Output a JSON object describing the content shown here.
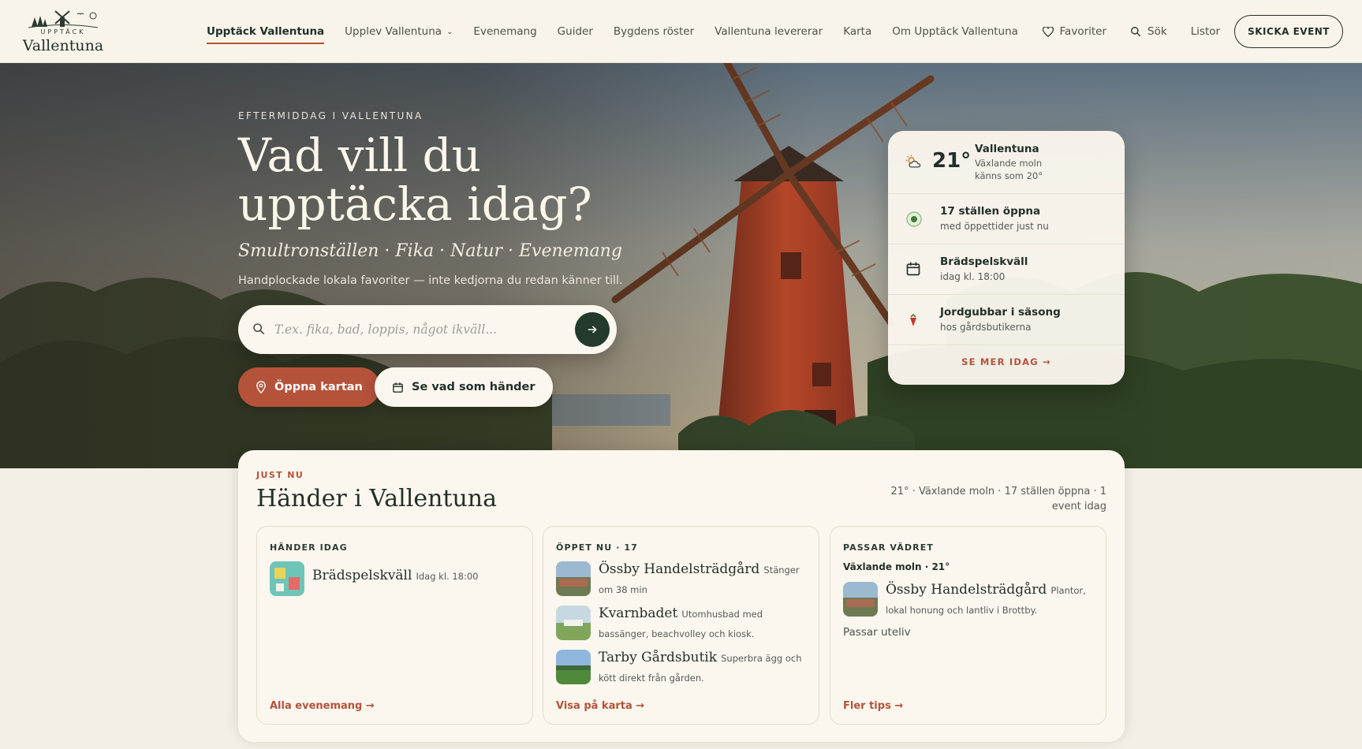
{
  "logo": {
    "small": "UPPTÄCK",
    "big": "Vallentuna"
  },
  "nav": {
    "items": [
      {
        "label": "Upptäck Vallentuna",
        "active": true
      },
      {
        "label": "Upplev Vallentuna",
        "dropdown": true
      },
      {
        "label": "Evenemang"
      },
      {
        "label": "Guider"
      },
      {
        "label": "Bygdens röster"
      },
      {
        "label": "Vallentuna levererar"
      },
      {
        "label": "Karta"
      },
      {
        "label": "Om Upptäck Vallentuna"
      }
    ]
  },
  "utility": {
    "favorites": "Favoriter",
    "search": "Sök",
    "lists": "Listor",
    "cta": "SKICKA EVENT"
  },
  "hero": {
    "eyebrow": "EFTERMIDDAG I VALLENTUNA",
    "title": "Vad vill du upptäcka idag?",
    "tags": "Smultronställen · Fika · Natur · Evenemang",
    "subtitle": "Handplockade lokala favoriter — inte kedjorna du redan känner till.",
    "search_placeholder": "T.ex. fika, bad, loppis, något ikväll...",
    "primary_button": "Öppna kartan",
    "secondary_button": "Se vad som händer"
  },
  "today_widget": {
    "temperature": "21°",
    "city": "Vallentuna",
    "condition": "Växlande moln",
    "feels_like": "känns som 20°",
    "rows": [
      {
        "icon": "open-status-icon",
        "title": "17 ställen öppna",
        "sub": "med öppettider just nu"
      },
      {
        "icon": "calendar-icon",
        "title": "Brädspelskväll",
        "sub": "idag kl. 18:00"
      },
      {
        "icon": "strawberry-icon",
        "title": "Jordgubbar i säsong",
        "sub": "hos gårdsbutikerna"
      }
    ],
    "more_link": "SE MER IDAG →"
  },
  "just_now": {
    "eyebrow": "JUST NU",
    "title": "Händer i Vallentuna",
    "status": "21° · Växlande moln · 17 ställen öppna · 1 event idag",
    "cards": [
      {
        "heading": "HÄNDER IDAG",
        "items": [
          {
            "name": "Brädspelskväll",
            "note": "Idag kl. 18:00",
            "thumb": "boardgame"
          }
        ],
        "link": "Alla evenemang →"
      },
      {
        "heading": "ÖPPET NU · 17",
        "items": [
          {
            "name": "Össby Handelsträdgård",
            "note": "Stänger om 38 min",
            "thumb": "garden"
          },
          {
            "name": "Kvarnbadet",
            "note": "Utomhusbad med bassänger, beachvolley och kiosk.",
            "thumb": "beach"
          },
          {
            "name": "Tarby Gårdsbutik",
            "note": "Superbra ägg och kött direkt från gården.",
            "thumb": "field"
          }
        ],
        "link": "Visa på karta →"
      },
      {
        "heading": "PASSAR VÄDRET",
        "weather": "Växlande moln · 21°",
        "items": [
          {
            "name": "Össby Handelsträdgård",
            "note": "Plantor, lokal honung och lantliv i Brottby.",
            "thumb": "garden"
          }
        ],
        "footnote": "Passar uteliv",
        "link": "Fler tips →"
      }
    ]
  },
  "colors": {
    "accent": "#b5523a",
    "forest": "#233a2d",
    "cream": "#fbf7ee",
    "background": "#f4efe4"
  }
}
